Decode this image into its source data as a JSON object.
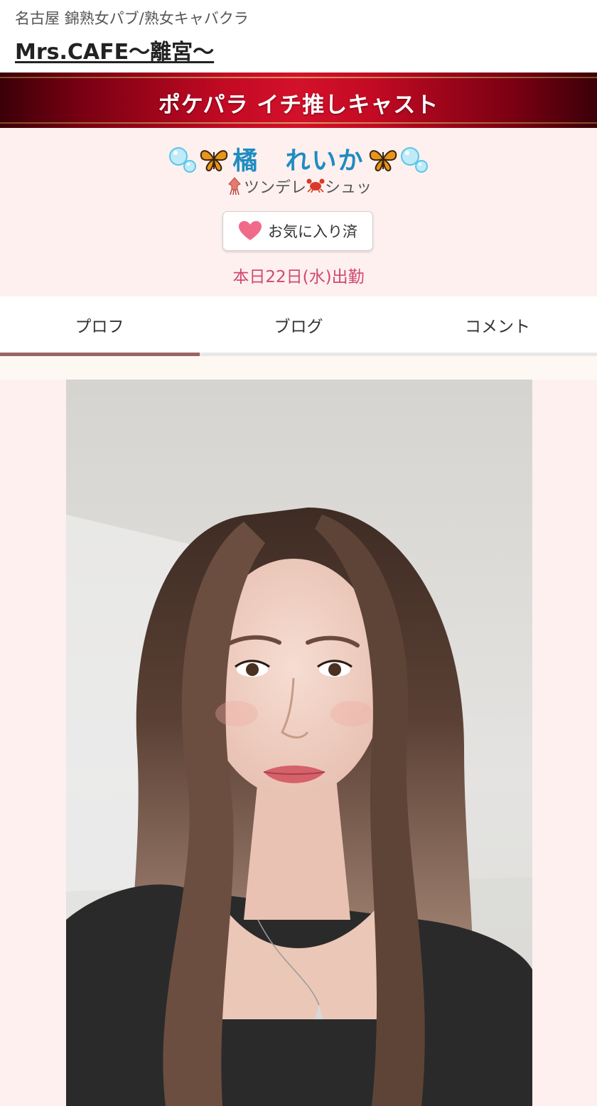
{
  "header": {
    "subtitle": "名古屋 錦熟女パブ/熟女キャバクラ",
    "shop_name": "Mrs.CAFE〜離宮〜"
  },
  "banner": {
    "title": "ポケパラ イチ推しキャスト"
  },
  "profile": {
    "name": "橘　れいか",
    "name_left_icons": [
      "bubbles-icon",
      "butterfly-icon"
    ],
    "name_right_icons": [
      "butterfly-icon",
      "bubbles-icon"
    ],
    "tagline_part1": "ツンデレ",
    "tagline_part2": "シュッ",
    "tagline_icons": [
      "squid-icon",
      "crab-icon"
    ],
    "favorite_label": "お気に入り済",
    "attendance": "本日22日(水)出勤"
  },
  "tabs": [
    {
      "label": "プロフ",
      "active": true
    },
    {
      "label": "ブログ",
      "active": false
    },
    {
      "label": "コメント",
      "active": false
    }
  ],
  "colors": {
    "banner_red": "#c40a24",
    "name_blue": "#1e8cc0",
    "attendance_pink": "#d04a6a",
    "heart_pink": "#f06a8a",
    "tab_active": "#9a6464",
    "page_bg": "#fff0f0"
  },
  "photo": {
    "alt_name": "cast-profile-photo"
  }
}
